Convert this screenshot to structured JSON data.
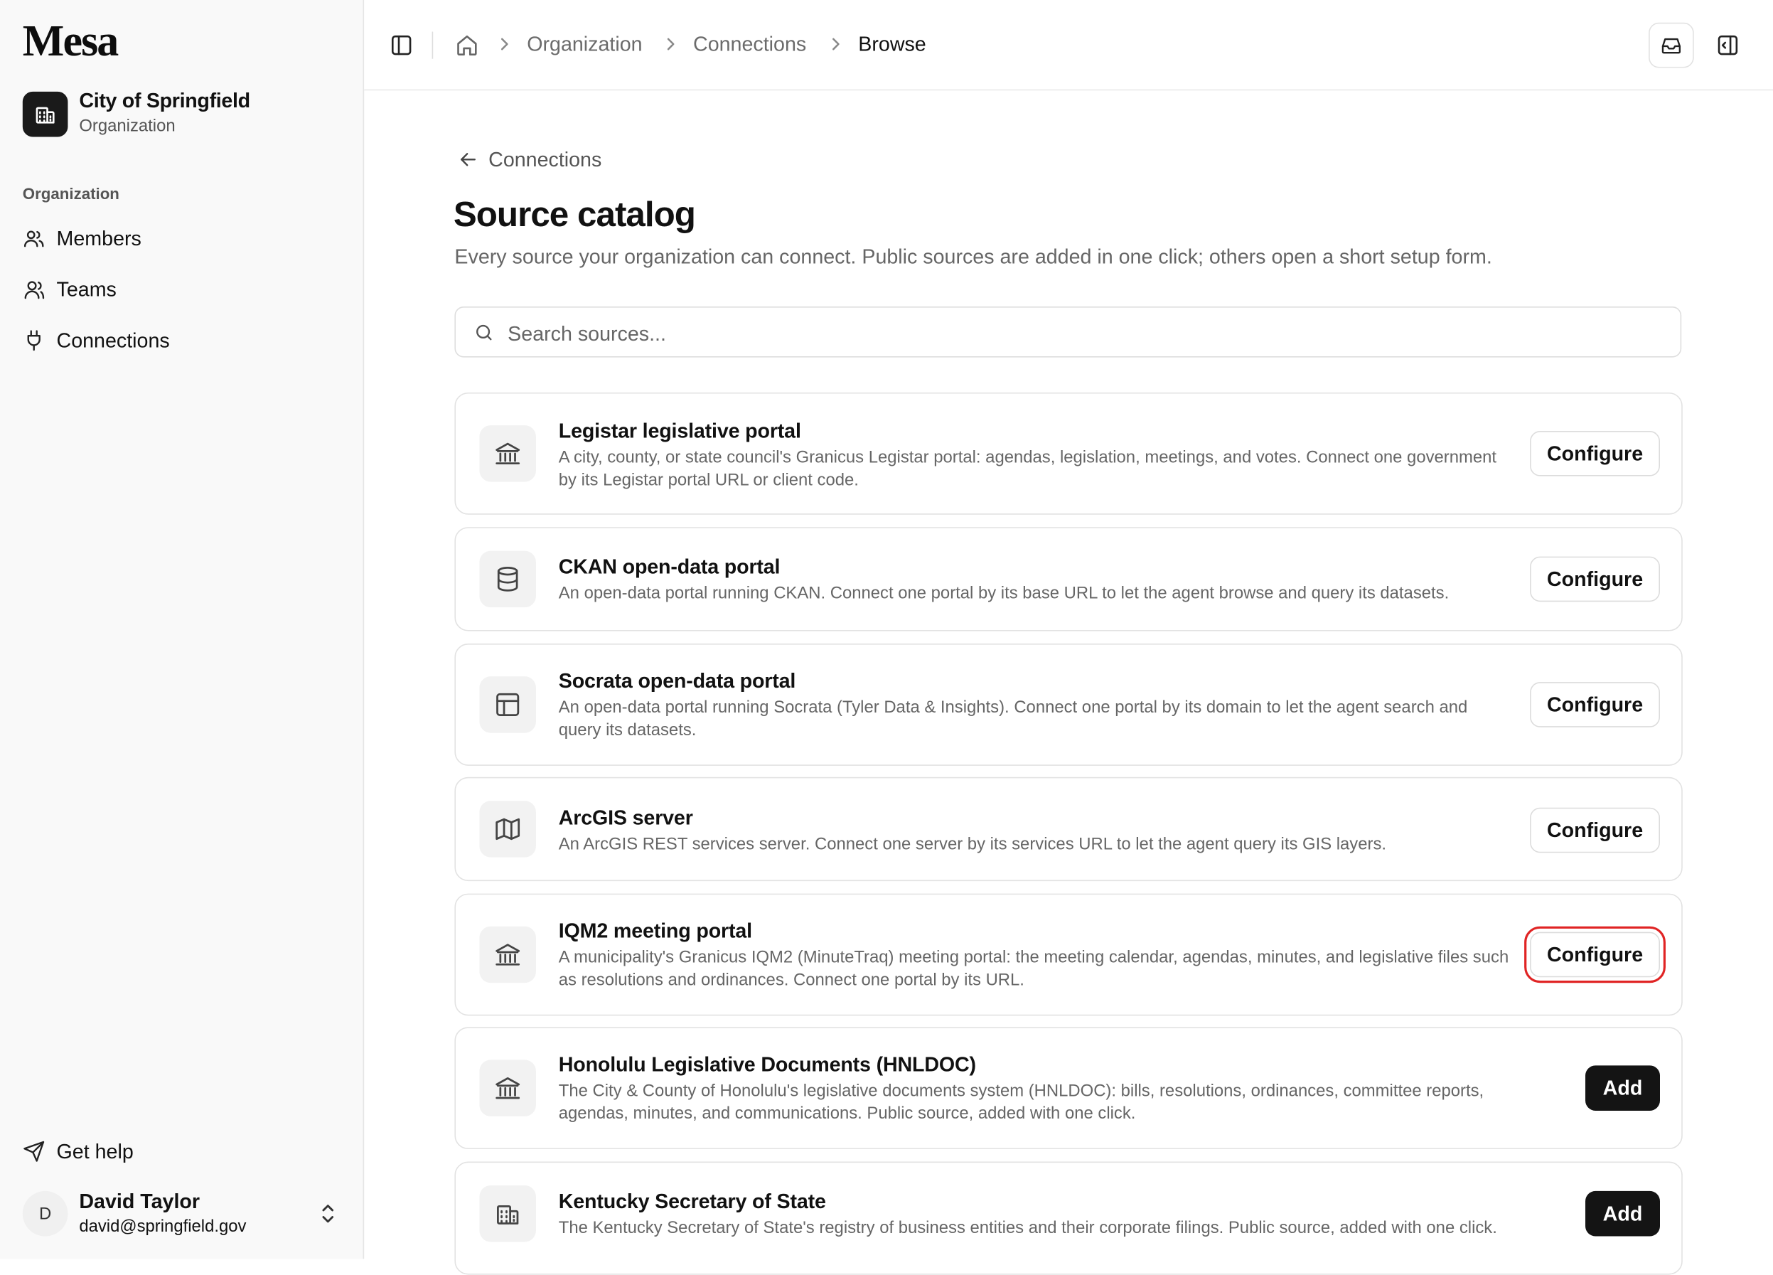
{
  "app": {
    "name": "Mesa"
  },
  "org": {
    "name": "City of Springfield",
    "type": "Organization"
  },
  "nav": {
    "heading": "Organization",
    "items": [
      {
        "label": "Members",
        "icon": "users-icon"
      },
      {
        "label": "Teams",
        "icon": "user-group-icon"
      },
      {
        "label": "Connections",
        "icon": "plug-icon"
      }
    ],
    "help": "Get help"
  },
  "user": {
    "initial": "D",
    "name": "David Taylor",
    "email": "david@springfield.gov"
  },
  "breadcrumb": [
    "Organization",
    "Connections",
    "Browse"
  ],
  "main": {
    "back_label": "Connections",
    "title": "Source catalog",
    "description": "Every source your organization can connect. Public sources are added in one click; others open a short setup form.",
    "search_placeholder": "Search sources..."
  },
  "sources": [
    {
      "title": "Legistar legislative portal",
      "description": "A city, county, or state council's Granicus Legistar portal: agendas, legislation, meetings, and votes. Connect one government by its Legistar portal URL or client code.",
      "icon": "landmark-icon",
      "action": "Configure"
    },
    {
      "title": "CKAN open-data portal",
      "description": "An open-data portal running CKAN. Connect one portal by its base URL to let the agent browse and query its datasets.",
      "icon": "database-icon",
      "action": "Configure"
    },
    {
      "title": "Socrata open-data portal",
      "description": "An open-data portal running Socrata (Tyler Data & Insights). Connect one portal by its domain to let the agent search and query its datasets.",
      "icon": "table-icon",
      "action": "Configure"
    },
    {
      "title": "ArcGIS server",
      "description": "An ArcGIS REST services server. Connect one server by its services URL to let the agent query its GIS layers.",
      "icon": "map-icon",
      "action": "Configure"
    },
    {
      "title": "IQM2 meeting portal",
      "description": "A municipality's Granicus IQM2 (MinuteTraq) meeting portal: the meeting calendar, agendas, minutes, and legislative files such as resolutions and ordinances. Connect one portal by its URL.",
      "icon": "landmark-icon",
      "action": "Configure"
    },
    {
      "title": "Honolulu Legislative Documents (HNLDOC)",
      "description": "The City & County of Honolulu's legislative documents system (HNLDOC): bills, resolutions, ordinances, committee reports, agendas, minutes, and communications. Public source, added with one click.",
      "icon": "landmark-icon",
      "action": "Add"
    },
    {
      "title": "Kentucky Secretary of State",
      "description": "The Kentucky Secretary of State's registry of business entities and their corporate filings. Public source, added with one click.",
      "icon": "building-icon",
      "action": "Add"
    }
  ],
  "colors": {
    "primary_button": "#141414",
    "focus_ring": "#e02424",
    "sidebar_bg": "#f9f9f9"
  }
}
